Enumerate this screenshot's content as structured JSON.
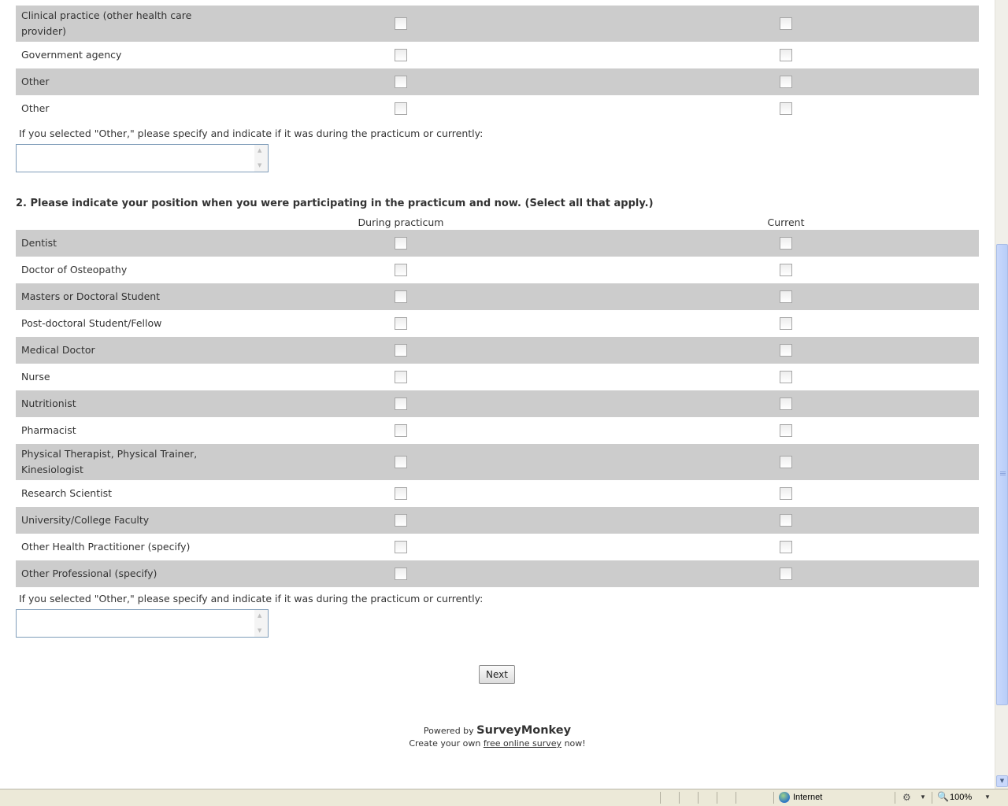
{
  "question1": {
    "rows": [
      {
        "label": "Clinical practice (other health care provider)"
      },
      {
        "label": "Government agency"
      },
      {
        "label": "Other"
      },
      {
        "label": "Other"
      }
    ],
    "other_prompt": "If you selected \"Other,\" please specify and indicate if it was during the practicum or currently:",
    "other_value": ""
  },
  "question2": {
    "title": "2. Please indicate your position when you were participating in the practicum and now. (Select all that apply.)",
    "columns": [
      "During practicum",
      "Current"
    ],
    "rows": [
      {
        "label": "Dentist"
      },
      {
        "label": "Doctor of Osteopathy"
      },
      {
        "label": "Masters or Doctoral Student"
      },
      {
        "label": "Post-doctoral Student/Fellow"
      },
      {
        "label": "Medical Doctor"
      },
      {
        "label": "Nurse"
      },
      {
        "label": "Nutritionist"
      },
      {
        "label": "Pharmacist"
      },
      {
        "label": "Physical Therapist, Physical Trainer, Kinesiologist"
      },
      {
        "label": "Research Scientist"
      },
      {
        "label": "University/College Faculty"
      },
      {
        "label": "Other Health Practitioner (specify)"
      },
      {
        "label": "Other Professional (specify)"
      }
    ],
    "other_prompt": "If you selected \"Other,\" please specify and indicate if it was during the practicum or currently:",
    "other_value": ""
  },
  "next_button": "Next",
  "footer": {
    "powered_prefix": "Powered by",
    "brand": "SurveyMonkey",
    "create_prefix": "Create your own",
    "link_text": "free online survey",
    "create_suffix": "now!"
  },
  "statusbar": {
    "zone": "Internet",
    "zoom": "100%"
  },
  "colors": {
    "row_shade": "#cccccc",
    "text": "#333333"
  }
}
